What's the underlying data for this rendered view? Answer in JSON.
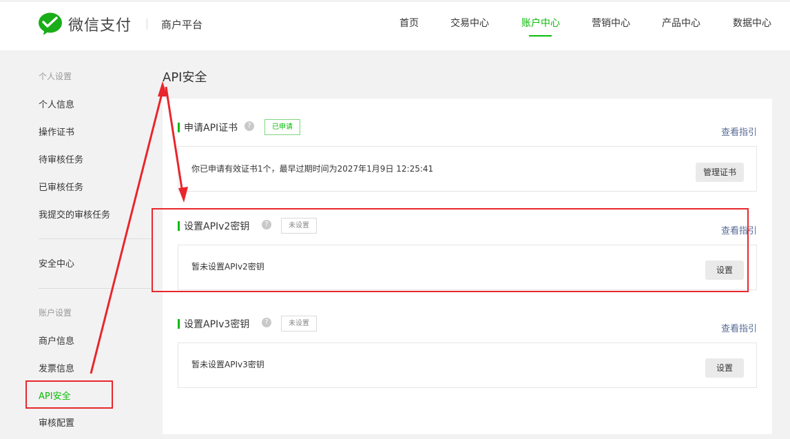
{
  "header": {
    "brand": "微信支付",
    "subtitle": "商户平台",
    "nav": [
      {
        "label": "首页",
        "active": false
      },
      {
        "label": "交易中心",
        "active": false
      },
      {
        "label": "账户中心",
        "active": true
      },
      {
        "label": "营销中心",
        "active": false
      },
      {
        "label": "产品中心",
        "active": false
      },
      {
        "label": "数据中心",
        "active": false
      }
    ]
  },
  "sidebar": {
    "group_personal": "个人设置",
    "personal_items": [
      "个人信息",
      "操作证书",
      "待审核任务",
      "已审核任务",
      "我提交的审核任务"
    ],
    "security": "安全中心",
    "group_account": "账户设置",
    "account_items": [
      "商户信息",
      "发票信息",
      "API安全",
      "审核配置"
    ],
    "active_item": "API安全"
  },
  "main": {
    "title": "API安全",
    "help_glyph": "?",
    "sections": [
      {
        "title": "申请API证书",
        "status": "已申请",
        "guide": "查看指引",
        "text": "你已申请有效证书1个，最早过期时间为2027年1月9日 12:25:41",
        "button": "管理证书"
      },
      {
        "title": "设置APIv2密钥",
        "status": "未设置",
        "guide": "查看指引",
        "text": "暂未设置APIv2密钥",
        "button": "设置"
      },
      {
        "title": "设置APIv3密钥",
        "status": "未设置",
        "guide": "查看指引",
        "text": "暂未设置APIv3密钥",
        "button": "设置"
      }
    ]
  },
  "colors": {
    "accent": "#09bb07",
    "link": "#576b95",
    "annotation": "#e8262b"
  },
  "icons": [
    "wechat-pay-logo-icon",
    "help-icon"
  ]
}
